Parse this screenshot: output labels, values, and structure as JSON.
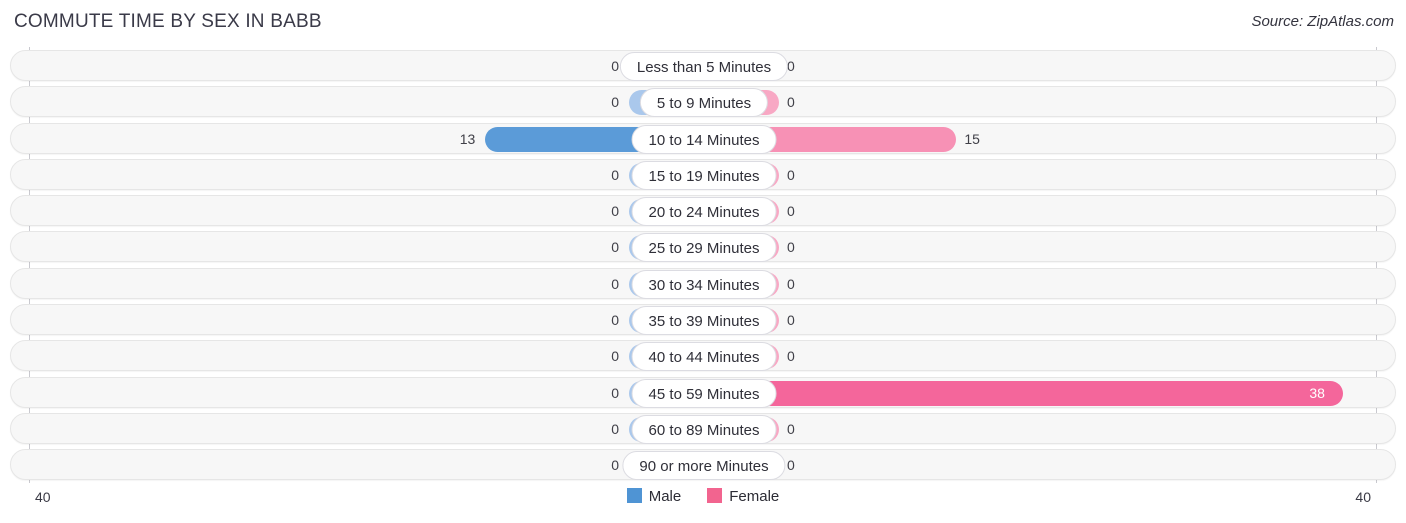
{
  "header": {
    "title": "COMMUTE TIME BY SEX IN BABB",
    "source": "Source: ZipAtlas.com"
  },
  "axis": {
    "left_label": "40",
    "right_label": "40",
    "max": 40
  },
  "legend": {
    "items": [
      {
        "label": "Male",
        "color": "#4f94d4"
      },
      {
        "label": "Female",
        "color": "#f2648f"
      }
    ]
  },
  "colors": {
    "male_bar": "#5b9bd8",
    "male_stub": "#aac8ec",
    "female_bar": "#f4669b",
    "female_mid": "#f791b5",
    "female_stub": "#f8a8c4",
    "track": "#f7f7f7",
    "track_border": "#e6e6e6"
  },
  "chart_data": {
    "type": "bar",
    "title": "COMMUTE TIME BY SEX IN BABB",
    "orientation": "horizontal-diverging",
    "xlabel": "",
    "ylabel": "",
    "xlim": [
      -40,
      40
    ],
    "grid": false,
    "legend_position": "bottom-center",
    "categories": [
      "Less than 5 Minutes",
      "5 to 9 Minutes",
      "10 to 14 Minutes",
      "15 to 19 Minutes",
      "20 to 24 Minutes",
      "25 to 29 Minutes",
      "30 to 34 Minutes",
      "35 to 39 Minutes",
      "40 to 44 Minutes",
      "45 to 59 Minutes",
      "60 to 89 Minutes",
      "90 or more Minutes"
    ],
    "series": [
      {
        "name": "Male",
        "values": [
          0,
          0,
          13,
          0,
          0,
          0,
          0,
          0,
          0,
          0,
          0,
          0
        ],
        "labels": [
          "0",
          "0",
          "13",
          "0",
          "0",
          "0",
          "0",
          "0",
          "0",
          "0",
          "0",
          "0"
        ]
      },
      {
        "name": "Female",
        "values": [
          0,
          0,
          15,
          0,
          0,
          0,
          0,
          0,
          0,
          38,
          0,
          0
        ],
        "labels": [
          "0",
          "0",
          "15",
          "0",
          "0",
          "0",
          "0",
          "0",
          "0",
          "38",
          "0",
          "0"
        ]
      }
    ]
  }
}
